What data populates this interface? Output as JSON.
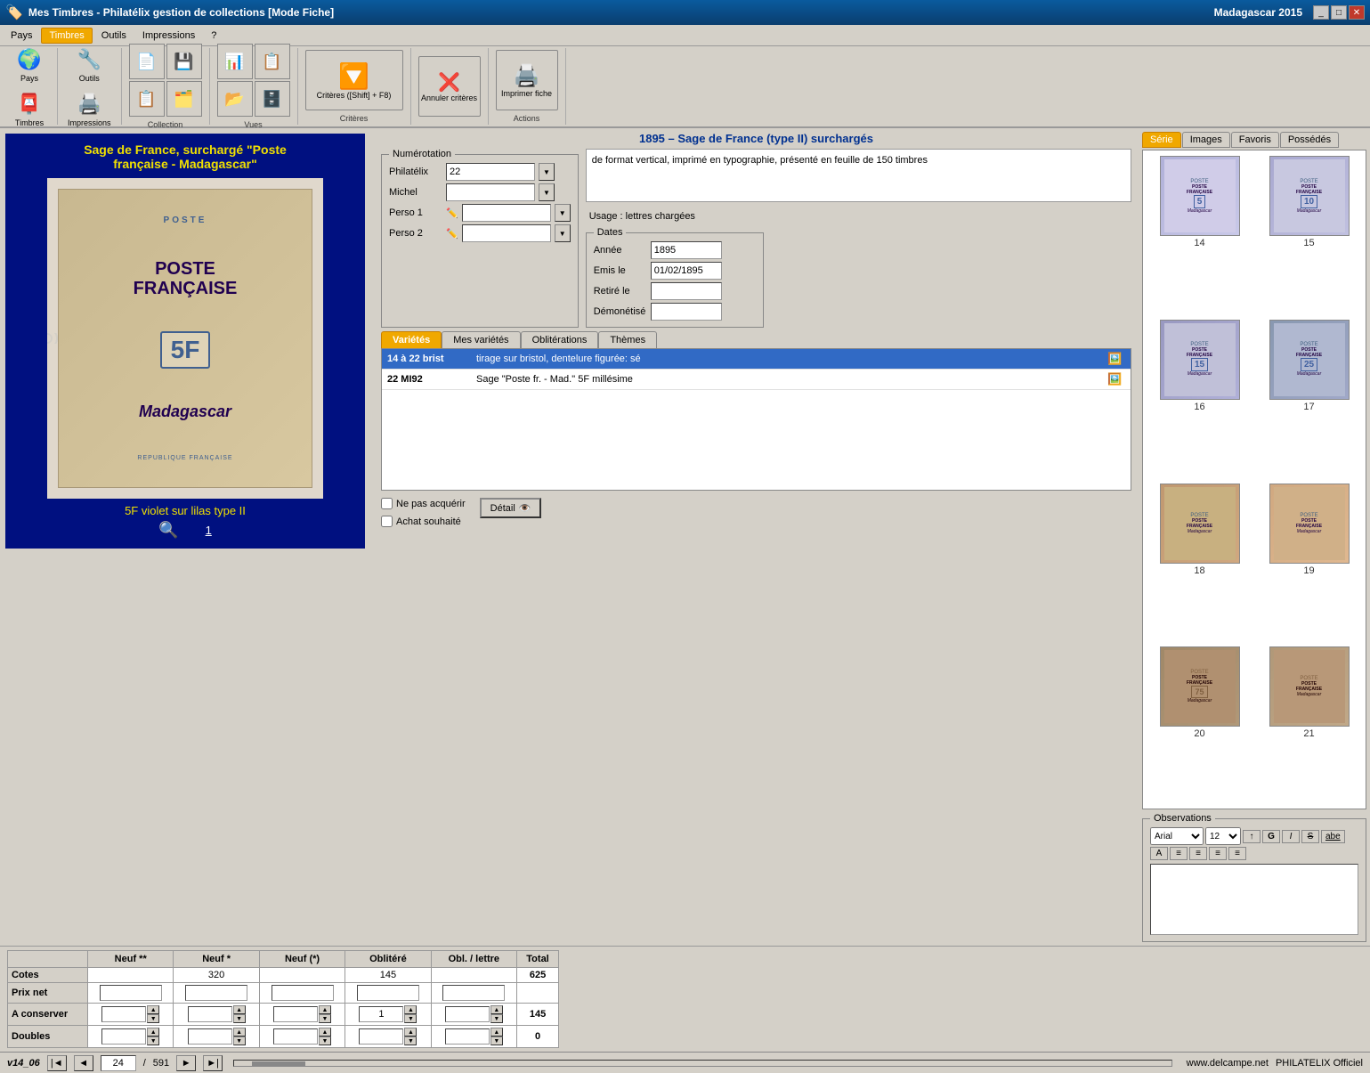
{
  "window": {
    "title": "Mes Timbres - Philatélix gestion de collections [Mode Fiche]",
    "right_title": "Madagascar 2015",
    "controls": [
      "_",
      "□",
      "✕"
    ]
  },
  "menu": {
    "items": [
      "Pays",
      "Timbres",
      "Outils",
      "Impressions",
      "?"
    ],
    "active": "Timbres"
  },
  "toolbar": {
    "groups": [
      {
        "name": "Collection",
        "buttons": [
          {
            "label": "Pays",
            "icon": "🌍"
          },
          {
            "label": "Timbres",
            "icon": "📮"
          },
          {
            "label": "Outils",
            "icon": "🔧"
          },
          {
            "label": "Impressions",
            "icon": "🖨️"
          }
        ]
      }
    ],
    "criteria_label": "Critères ([Shift] + F8)",
    "cancel_label": "Annuler critères",
    "print_label": "Imprimer fiche",
    "sections": [
      "Collection",
      "Vues",
      "Critères",
      "Actions"
    ]
  },
  "stamp": {
    "display_title_line1": "Sage de France, surchargé \"Poste",
    "display_title_line2": "française - Madagascar\"",
    "caption": "5F violet sur lilas type II",
    "number": "1",
    "inner_text": {
      "poste": "POSTE",
      "big": "POSTE\nFRANÇAISE",
      "value": "5F",
      "place": "Madagascar",
      "republic": "REPUBLIQUE FRANÇAISE"
    }
  },
  "section_title": "1895 – Sage de France (type II) surchargés",
  "numerotation": {
    "legend": "Numérotation",
    "fields": [
      {
        "label": "Philatélix",
        "value": "22",
        "has_dropdown": true
      },
      {
        "label": "Michel",
        "value": "",
        "has_dropdown": true
      },
      {
        "label": "Perso 1",
        "value": "",
        "has_dropdown": true,
        "has_pencil": true
      },
      {
        "label": "Perso 2",
        "value": "",
        "has_dropdown": true,
        "has_pencil": true
      }
    ]
  },
  "dates": {
    "legend": "Dates",
    "fields": [
      {
        "label": "Année",
        "value": "1895"
      },
      {
        "label": "Emis le",
        "value": "01/02/1895"
      },
      {
        "label": "Retiré le",
        "value": ""
      },
      {
        "label": "Démonétisé",
        "value": ""
      }
    ]
  },
  "description": "de format vertical, imprimé en typographie, présenté en feuille de 150 timbres",
  "usage": "Usage : lettres chargées",
  "tabs": {
    "items": [
      "Variétés",
      "Mes variétés",
      "Oblitérations",
      "Thèmes"
    ],
    "active": "Variétés",
    "rows": [
      {
        "code": "14 à 22 brist",
        "description": "tirage sur bristol, dentelure figurée: sé",
        "has_icon": true,
        "selected": true
      },
      {
        "code": "22 MI92",
        "description": "Sage \"Poste fr. - Mad.\" 5F millésime",
        "has_icon": true,
        "selected": false
      }
    ]
  },
  "right_panel": {
    "tabs": [
      "Série",
      "Images",
      "Favoris",
      "Possédés"
    ],
    "active": "Série",
    "stamps": [
      {
        "number": "14",
        "value": "5",
        "color": "#9090c0"
      },
      {
        "number": "15",
        "value": "10",
        "color": "#8888b8"
      },
      {
        "number": "16",
        "value": "15",
        "color": "#7878a8"
      },
      {
        "number": "17",
        "value": "25",
        "color": "#8898b8"
      },
      {
        "number": "18",
        "value": "",
        "color": "#c09870",
        "has_text": true
      },
      {
        "number": "19",
        "value": "",
        "color": "#d0a880",
        "has_text": true
      },
      {
        "number": "20",
        "value": "75",
        "color": "#a08868"
      },
      {
        "number": "21",
        "value": "",
        "color": "#b09878",
        "has_text": true
      }
    ]
  },
  "observations": {
    "legend": "Observations",
    "toolbar_buttons": [
      "▼",
      "▼",
      "↑↓",
      "G",
      "I",
      "S",
      "abe",
      "A",
      "≡",
      "≡",
      "≡",
      "≡"
    ]
  },
  "checkboxes": {
    "ne_pas_acquerir": "Ne pas acquérir",
    "achat_souhaite": "Achat souhaité",
    "detail_label": "Détail"
  },
  "grid": {
    "columns": [
      "Neuf **",
      "Neuf *",
      "Neuf (*)",
      "Oblitéré",
      "Obl. / lettre",
      "Total"
    ],
    "rows": [
      {
        "label": "Cotes",
        "values": [
          "",
          "320",
          "",
          "145",
          "",
          "625"
        ],
        "bold_last": true
      },
      {
        "label": "Prix net",
        "values": [
          "",
          "",
          "",
          "",
          "",
          ""
        ]
      },
      {
        "label": "A conserver",
        "values": [
          "",
          "",
          "",
          "1",
          "",
          "145"
        ],
        "spinners": [
          true,
          true,
          true,
          true,
          true,
          false
        ]
      },
      {
        "label": "Doubles",
        "values": [
          "",
          "",
          "",
          "",
          "",
          "0"
        ],
        "spinners": [
          true,
          true,
          true,
          true,
          true,
          false
        ]
      }
    ]
  },
  "status": {
    "version": "v14_06",
    "current_page": "24",
    "total_pages": "591",
    "website": "www.delcampe.net",
    "software": "PHILATELIX Officiel"
  }
}
